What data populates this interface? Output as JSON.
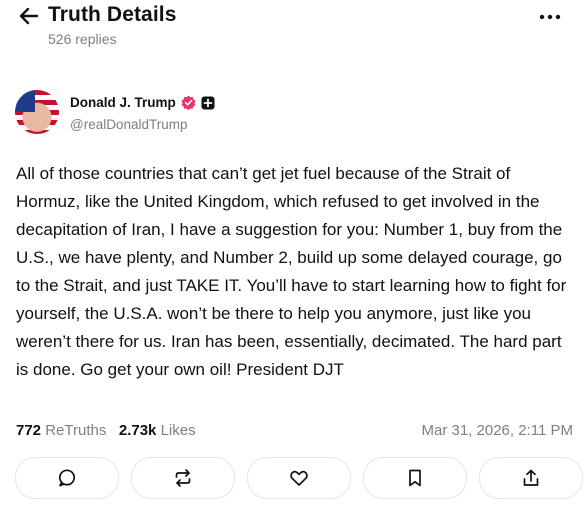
{
  "header": {
    "title": "Truth Details",
    "replies": "526 replies"
  },
  "post": {
    "author_name": "Donald J. Trump",
    "handle": "@realDonaldTrump",
    "text": "All of those countries that can’t get jet fuel because of the Strait of Hormuz, like the United Kingdom, which refused to get involved in the decapitation of Iran, I have a suggestion for you: Number 1, buy from the U.S., we have plenty, and Number 2, build up some delayed courage, go to the Strait, and just TAKE IT. You’ll have to start learning how to fight for yourself, the U.S.A. won’t be there to help you anymore, just like you weren’t there for us. Iran has been, essentially, decimated. The hard part is done. Go get your own oil! President DJT",
    "retruths_count": "772",
    "retruths_label": "ReTruths",
    "likes_count": "2.73k",
    "likes_label": "Likes",
    "timestamp": "Mar 31, 2026, 2:11 PM"
  },
  "actions": [
    "reply-icon",
    "retruth-icon",
    "like-icon",
    "bookmark-icon",
    "share-icon"
  ],
  "colors": {
    "verified": "#e0396b",
    "muted": "#7a7f8a",
    "border": "#e3e5ea",
    "text": "#0f1115"
  }
}
